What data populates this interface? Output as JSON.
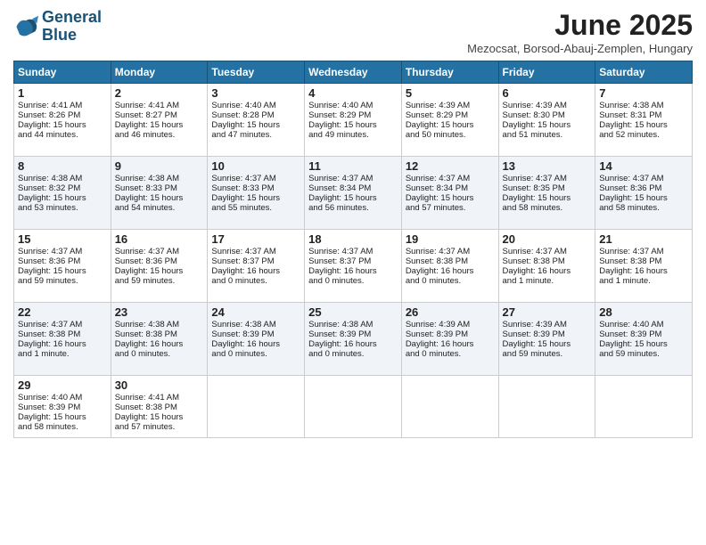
{
  "header": {
    "logo_line1": "General",
    "logo_line2": "Blue",
    "month_title": "June 2025",
    "subtitle": "Mezocsat, Borsod-Abauj-Zemplen, Hungary"
  },
  "days_of_week": [
    "Sunday",
    "Monday",
    "Tuesday",
    "Wednesday",
    "Thursday",
    "Friday",
    "Saturday"
  ],
  "weeks": [
    [
      {
        "day": "1",
        "lines": [
          "Sunrise: 4:41 AM",
          "Sunset: 8:26 PM",
          "Daylight: 15 hours",
          "and 44 minutes."
        ]
      },
      {
        "day": "2",
        "lines": [
          "Sunrise: 4:41 AM",
          "Sunset: 8:27 PM",
          "Daylight: 15 hours",
          "and 46 minutes."
        ]
      },
      {
        "day": "3",
        "lines": [
          "Sunrise: 4:40 AM",
          "Sunset: 8:28 PM",
          "Daylight: 15 hours",
          "and 47 minutes."
        ]
      },
      {
        "day": "4",
        "lines": [
          "Sunrise: 4:40 AM",
          "Sunset: 8:29 PM",
          "Daylight: 15 hours",
          "and 49 minutes."
        ]
      },
      {
        "day": "5",
        "lines": [
          "Sunrise: 4:39 AM",
          "Sunset: 8:29 PM",
          "Daylight: 15 hours",
          "and 50 minutes."
        ]
      },
      {
        "day": "6",
        "lines": [
          "Sunrise: 4:39 AM",
          "Sunset: 8:30 PM",
          "Daylight: 15 hours",
          "and 51 minutes."
        ]
      },
      {
        "day": "7",
        "lines": [
          "Sunrise: 4:38 AM",
          "Sunset: 8:31 PM",
          "Daylight: 15 hours",
          "and 52 minutes."
        ]
      }
    ],
    [
      {
        "day": "8",
        "lines": [
          "Sunrise: 4:38 AM",
          "Sunset: 8:32 PM",
          "Daylight: 15 hours",
          "and 53 minutes."
        ]
      },
      {
        "day": "9",
        "lines": [
          "Sunrise: 4:38 AM",
          "Sunset: 8:33 PM",
          "Daylight: 15 hours",
          "and 54 minutes."
        ]
      },
      {
        "day": "10",
        "lines": [
          "Sunrise: 4:37 AM",
          "Sunset: 8:33 PM",
          "Daylight: 15 hours",
          "and 55 minutes."
        ]
      },
      {
        "day": "11",
        "lines": [
          "Sunrise: 4:37 AM",
          "Sunset: 8:34 PM",
          "Daylight: 15 hours",
          "and 56 minutes."
        ]
      },
      {
        "day": "12",
        "lines": [
          "Sunrise: 4:37 AM",
          "Sunset: 8:34 PM",
          "Daylight: 15 hours",
          "and 57 minutes."
        ]
      },
      {
        "day": "13",
        "lines": [
          "Sunrise: 4:37 AM",
          "Sunset: 8:35 PM",
          "Daylight: 15 hours",
          "and 58 minutes."
        ]
      },
      {
        "day": "14",
        "lines": [
          "Sunrise: 4:37 AM",
          "Sunset: 8:36 PM",
          "Daylight: 15 hours",
          "and 58 minutes."
        ]
      }
    ],
    [
      {
        "day": "15",
        "lines": [
          "Sunrise: 4:37 AM",
          "Sunset: 8:36 PM",
          "Daylight: 15 hours",
          "and 59 minutes."
        ]
      },
      {
        "day": "16",
        "lines": [
          "Sunrise: 4:37 AM",
          "Sunset: 8:36 PM",
          "Daylight: 15 hours",
          "and 59 minutes."
        ]
      },
      {
        "day": "17",
        "lines": [
          "Sunrise: 4:37 AM",
          "Sunset: 8:37 PM",
          "Daylight: 16 hours",
          "and 0 minutes."
        ]
      },
      {
        "day": "18",
        "lines": [
          "Sunrise: 4:37 AM",
          "Sunset: 8:37 PM",
          "Daylight: 16 hours",
          "and 0 minutes."
        ]
      },
      {
        "day": "19",
        "lines": [
          "Sunrise: 4:37 AM",
          "Sunset: 8:38 PM",
          "Daylight: 16 hours",
          "and 0 minutes."
        ]
      },
      {
        "day": "20",
        "lines": [
          "Sunrise: 4:37 AM",
          "Sunset: 8:38 PM",
          "Daylight: 16 hours",
          "and 1 minute."
        ]
      },
      {
        "day": "21",
        "lines": [
          "Sunrise: 4:37 AM",
          "Sunset: 8:38 PM",
          "Daylight: 16 hours",
          "and 1 minute."
        ]
      }
    ],
    [
      {
        "day": "22",
        "lines": [
          "Sunrise: 4:37 AM",
          "Sunset: 8:38 PM",
          "Daylight: 16 hours",
          "and 1 minute."
        ]
      },
      {
        "day": "23",
        "lines": [
          "Sunrise: 4:38 AM",
          "Sunset: 8:38 PM",
          "Daylight: 16 hours",
          "and 0 minutes."
        ]
      },
      {
        "day": "24",
        "lines": [
          "Sunrise: 4:38 AM",
          "Sunset: 8:39 PM",
          "Daylight: 16 hours",
          "and 0 minutes."
        ]
      },
      {
        "day": "25",
        "lines": [
          "Sunrise: 4:38 AM",
          "Sunset: 8:39 PM",
          "Daylight: 16 hours",
          "and 0 minutes."
        ]
      },
      {
        "day": "26",
        "lines": [
          "Sunrise: 4:39 AM",
          "Sunset: 8:39 PM",
          "Daylight: 16 hours",
          "and 0 minutes."
        ]
      },
      {
        "day": "27",
        "lines": [
          "Sunrise: 4:39 AM",
          "Sunset: 8:39 PM",
          "Daylight: 15 hours",
          "and 59 minutes."
        ]
      },
      {
        "day": "28",
        "lines": [
          "Sunrise: 4:40 AM",
          "Sunset: 8:39 PM",
          "Daylight: 15 hours",
          "and 59 minutes."
        ]
      }
    ],
    [
      {
        "day": "29",
        "lines": [
          "Sunrise: 4:40 AM",
          "Sunset: 8:39 PM",
          "Daylight: 15 hours",
          "and 58 minutes."
        ]
      },
      {
        "day": "30",
        "lines": [
          "Sunrise: 4:41 AM",
          "Sunset: 8:38 PM",
          "Daylight: 15 hours",
          "and 57 minutes."
        ]
      },
      {
        "day": "",
        "lines": []
      },
      {
        "day": "",
        "lines": []
      },
      {
        "day": "",
        "lines": []
      },
      {
        "day": "",
        "lines": []
      },
      {
        "day": "",
        "lines": []
      }
    ]
  ]
}
